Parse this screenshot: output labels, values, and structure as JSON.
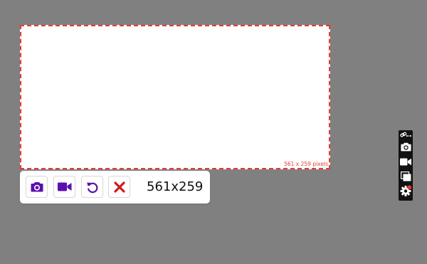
{
  "selection": {
    "size_label": "561 x 259 pixels",
    "border_color": "#e53935"
  },
  "toolbar": {
    "buttons": [
      {
        "icon": "camera-icon",
        "color": "#5b0fb0"
      },
      {
        "icon": "video-camera-icon",
        "color": "#5b0fb0"
      },
      {
        "icon": "undo-icon",
        "color": "#5b0fb0"
      },
      {
        "icon": "close-icon",
        "color": "#d11a1a"
      }
    ],
    "dimensions": "561x259"
  },
  "side_panel": {
    "items": [
      {
        "icon": "link-icon"
      },
      {
        "icon": "more-icon"
      },
      {
        "icon": "camera-icon"
      },
      {
        "icon": "video-camera-icon"
      },
      {
        "icon": "window-icon"
      },
      {
        "icon": "gear-icon",
        "badge_color": "#e53935"
      }
    ]
  },
  "colors": {
    "background": "#808080",
    "panel": "#121212",
    "accent": "#5b0fb0"
  }
}
